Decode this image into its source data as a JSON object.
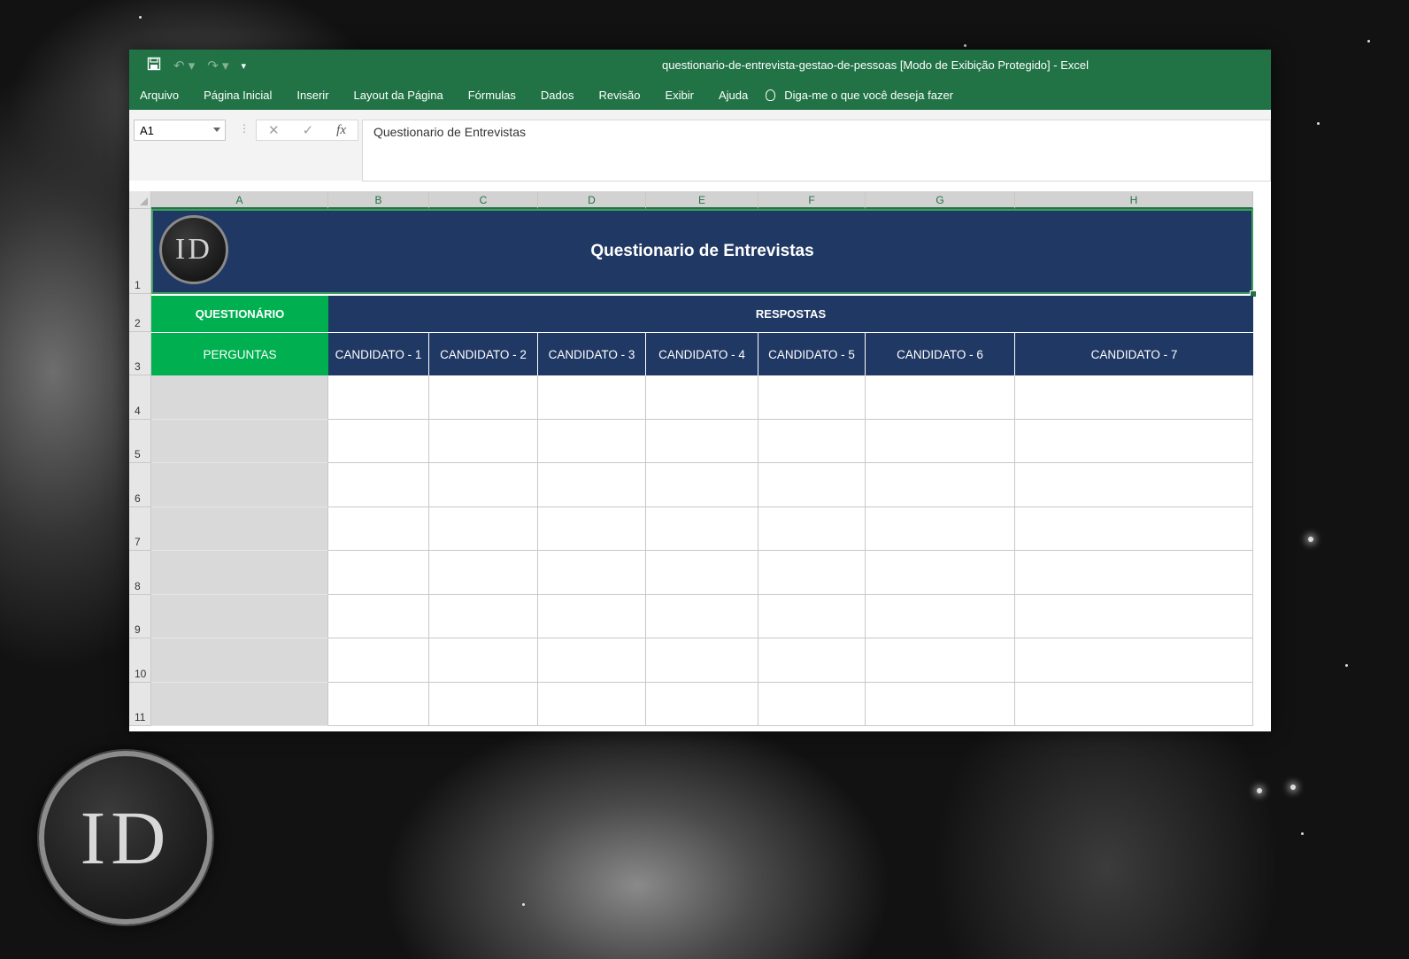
{
  "window": {
    "title": "questionario-de-entrevista-gestao-de-pessoas  [Modo de Exibição Protegido]  -  Excel"
  },
  "qat": {
    "save_icon": "save-icon",
    "undo_icon": "undo-icon",
    "redo_icon": "redo-icon",
    "customize_icon": "customize-qat-icon"
  },
  "ribbon": {
    "tabs": [
      "Arquivo",
      "Página Inicial",
      "Inserir",
      "Layout da Página",
      "Fórmulas",
      "Dados",
      "Revisão",
      "Exibir",
      "Ajuda"
    ],
    "tell_me": "Diga-me o que você deseja fazer"
  },
  "formula_bar": {
    "name_box": "A1",
    "content": "Questionario de Entrevistas"
  },
  "columns": [
    "A",
    "B",
    "C",
    "D",
    "E",
    "F",
    "G",
    "H"
  ],
  "rows": [
    "1",
    "2",
    "3",
    "4",
    "5",
    "6",
    "7",
    "8",
    "9",
    "10",
    "11"
  ],
  "sheet": {
    "title": "Questionario de Entrevistas",
    "logo_text": "ID",
    "questionario_label": "QUESTIONÁRIO",
    "respostas_label": "RESPOSTAS",
    "perguntas_label": "PERGUNTAS",
    "candidates": [
      "CANDIDATO - 1",
      "CANDIDATO - 2",
      "CANDIDATO - 3",
      "CANDIDATO - 4",
      "CANDIDATO - 5",
      "CANDIDATO - 6",
      "CANDIDATO - 7"
    ]
  },
  "colors": {
    "excel_green": "#217346",
    "header_navy": "#203864",
    "header_green": "#00b050",
    "question_fill": "#d9d9d9"
  },
  "background_logo_text": "ID"
}
